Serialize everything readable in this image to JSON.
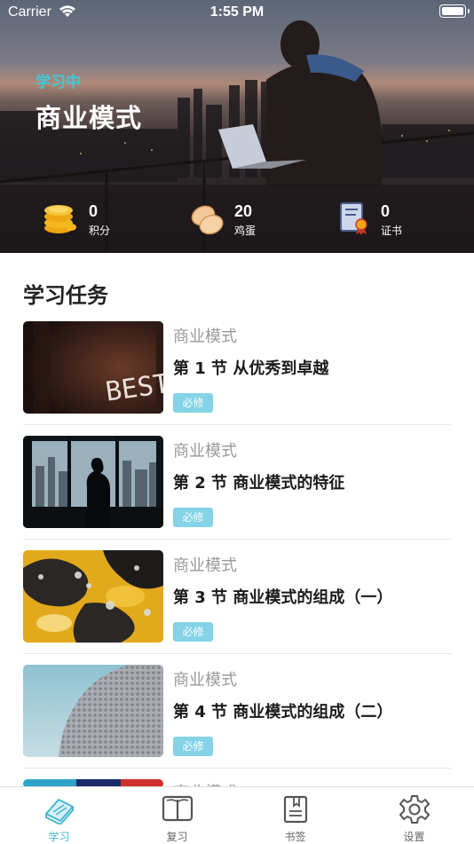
{
  "status_bar": {
    "carrier": "Carrier",
    "time": "1:55 PM"
  },
  "hero": {
    "status_label": "学习中",
    "course_title": "商业模式",
    "stats": [
      {
        "value": "0",
        "label": "积分",
        "icon": "coins-icon"
      },
      {
        "value": "20",
        "label": "鸡蛋",
        "icon": "eggs-icon"
      },
      {
        "value": "0",
        "label": "证书",
        "icon": "certificate-icon"
      }
    ]
  },
  "tasks_section": {
    "title": "学习任务",
    "items": [
      {
        "course": "商业模式",
        "lesson": "第 1 节  从优秀到卓越",
        "badge": "必修",
        "thumbnail": "neon-best-sign"
      },
      {
        "course": "商业模式",
        "lesson": "第 2 节  商业模式的特征",
        "badge": "必修",
        "thumbnail": "city-window-silhouette"
      },
      {
        "course": "商业模式",
        "lesson": "第 3 节  商业模式的组成（一）",
        "badge": "必修",
        "thumbnail": "fluid-art-yellow"
      },
      {
        "course": "商业模式",
        "lesson": "第 4 节  商业模式的组成（二）",
        "badge": "必修",
        "thumbnail": "hexagon-facade"
      },
      {
        "course": "商业模式",
        "thumbnail": "abstract-color"
      }
    ]
  },
  "tab_bar": {
    "active_color": "#46b5d1",
    "tabs": [
      {
        "label": "学习",
        "icon": "book-stack-icon",
        "active": true
      },
      {
        "label": "复习",
        "icon": "open-book-icon",
        "active": false
      },
      {
        "label": "书签",
        "icon": "bookmark-icon",
        "active": false
      },
      {
        "label": "设置",
        "icon": "gear-icon",
        "active": false
      }
    ]
  }
}
